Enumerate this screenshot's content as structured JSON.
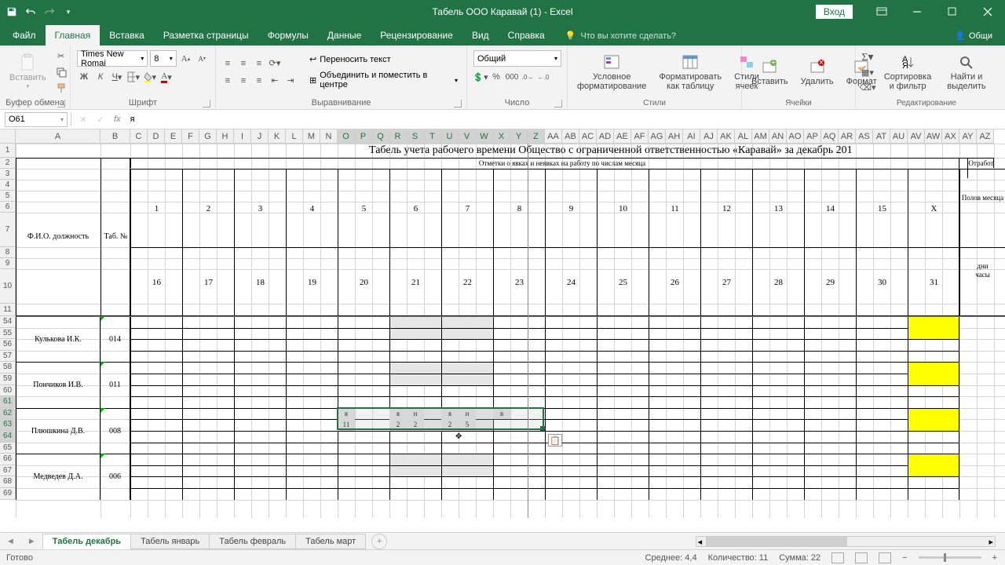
{
  "titlebar": {
    "title": "Табель ООО Каравай (1) - Excel",
    "login": "Вход"
  },
  "tabs": {
    "file": "Файл",
    "home": "Главная",
    "insert": "Вставка",
    "layout": "Разметка страницы",
    "formulas": "Формулы",
    "data": "Данные",
    "review": "Рецензирование",
    "view": "Вид",
    "help": "Справка",
    "tellme": "Что вы хотите сделать?",
    "share": "Общи"
  },
  "ribbon": {
    "clipboard": {
      "paste": "Вставить",
      "label": "Буфер обмена"
    },
    "font": {
      "name": "Times New Romai",
      "size": "8",
      "label": "Шрифт"
    },
    "align": {
      "wrap": "Переносить текст",
      "merge": "Объединить и поместить в центре",
      "label": "Выравнивание"
    },
    "number": {
      "format": "Общий",
      "label": "Число"
    },
    "styles": {
      "cond": "Условное форматирование",
      "table": "Форматировать как таблицу",
      "cell": "Стили ячеек",
      "label": "Стили"
    },
    "cells": {
      "insert": "Вставить",
      "delete": "Удалить",
      "format": "Формат",
      "label": "Ячейки"
    },
    "editing": {
      "sort": "Сортировка и фильтр",
      "find": "Найти и выделить",
      "label": "Редактирование"
    }
  },
  "formula": {
    "name": "O61",
    "value": "я"
  },
  "cols": [
    "A",
    "B",
    "C",
    "D",
    "E",
    "F",
    "G",
    "H",
    "I",
    "J",
    "K",
    "L",
    "M",
    "N",
    "O",
    "P",
    "Q",
    "R",
    "S",
    "T",
    "U",
    "V",
    "W",
    "X",
    "Y",
    "Z",
    "AA",
    "AB",
    "AC",
    "AD",
    "AE",
    "AF",
    "AG",
    "AH",
    "AI",
    "AJ",
    "AK",
    "AL",
    "AM",
    "AN",
    "AO",
    "AP",
    "AQ",
    "AR",
    "AS",
    "AT",
    "AU",
    "AV",
    "AW",
    "AX",
    "AY",
    "AZ"
  ],
  "rows_top": [
    "1",
    "2",
    "3",
    "4",
    "5",
    "6",
    "7",
    "8",
    "9",
    "10",
    "11"
  ],
  "rows_bot": [
    "54",
    "55",
    "56",
    "57",
    "58",
    "59",
    "60",
    "61",
    "62",
    "63",
    "64",
    "65",
    "66",
    "67",
    "68",
    "69"
  ],
  "workbook_title": "Табель учета рабочего времени Общество с ограниченной ответственностью «Каравай» за декабрь 201",
  "subtitle": "Отметки о явках и неявках на работу по числам месяца",
  "headers": {
    "fio": "Ф.И.О. должность",
    "tab": "Таб. №",
    "half": "Полов месяца",
    "dnihrs": "дни\nчас",
    "otrab": "Отработ"
  },
  "days1": [
    "1",
    "2",
    "3",
    "4",
    "5",
    "6",
    "7",
    "8",
    "9",
    "10",
    "11",
    "12",
    "13",
    "14",
    "15",
    "X"
  ],
  "days2": [
    "16",
    "17",
    "18",
    "19",
    "20",
    "21",
    "22",
    "23",
    "24",
    "25",
    "26",
    "27",
    "28",
    "29",
    "30",
    "31"
  ],
  "people": [
    {
      "name": "Кулькова И.К.",
      "tab": "014"
    },
    {
      "name": "Пончиков И.В.",
      "tab": "011"
    },
    {
      "name": "Плюшкина Д.В.",
      "tab": "008"
    },
    {
      "name": "Медведев Д.А.",
      "tab": "006"
    }
  ],
  "entry": {
    "r1": [
      "я",
      "",
      "",
      "я",
      "н",
      "",
      "я",
      "н",
      "",
      "в"
    ],
    "r2": [
      "11",
      "",
      "",
      "2",
      "2",
      "",
      "2",
      "5",
      "",
      ""
    ]
  },
  "sheet_tabs": [
    "Табель декабрь",
    "Табель январь",
    "Табель февраль",
    "Табель март"
  ],
  "status": {
    "ready": "Готово",
    "avg": "Среднее: 4,4",
    "count": "Количество: 11",
    "sum": "Сумма: 22"
  }
}
